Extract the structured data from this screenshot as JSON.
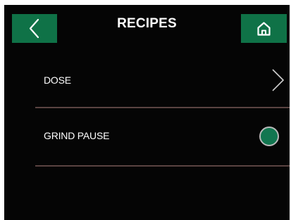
{
  "header": {
    "title": "RECIPES",
    "back_icon": "chevron-left-icon",
    "home_icon": "home-icon"
  },
  "menu": {
    "items": [
      {
        "label": "DOSE",
        "control": "chevron-right-icon"
      },
      {
        "label": "GRIND PAUSE",
        "control": "toggle",
        "state": "on"
      }
    ]
  },
  "colors": {
    "background": "#050505",
    "accent": "#0f7247",
    "divider": "#5a4341",
    "text": "#ffffff",
    "toggle_border": "#b9b9b9"
  }
}
